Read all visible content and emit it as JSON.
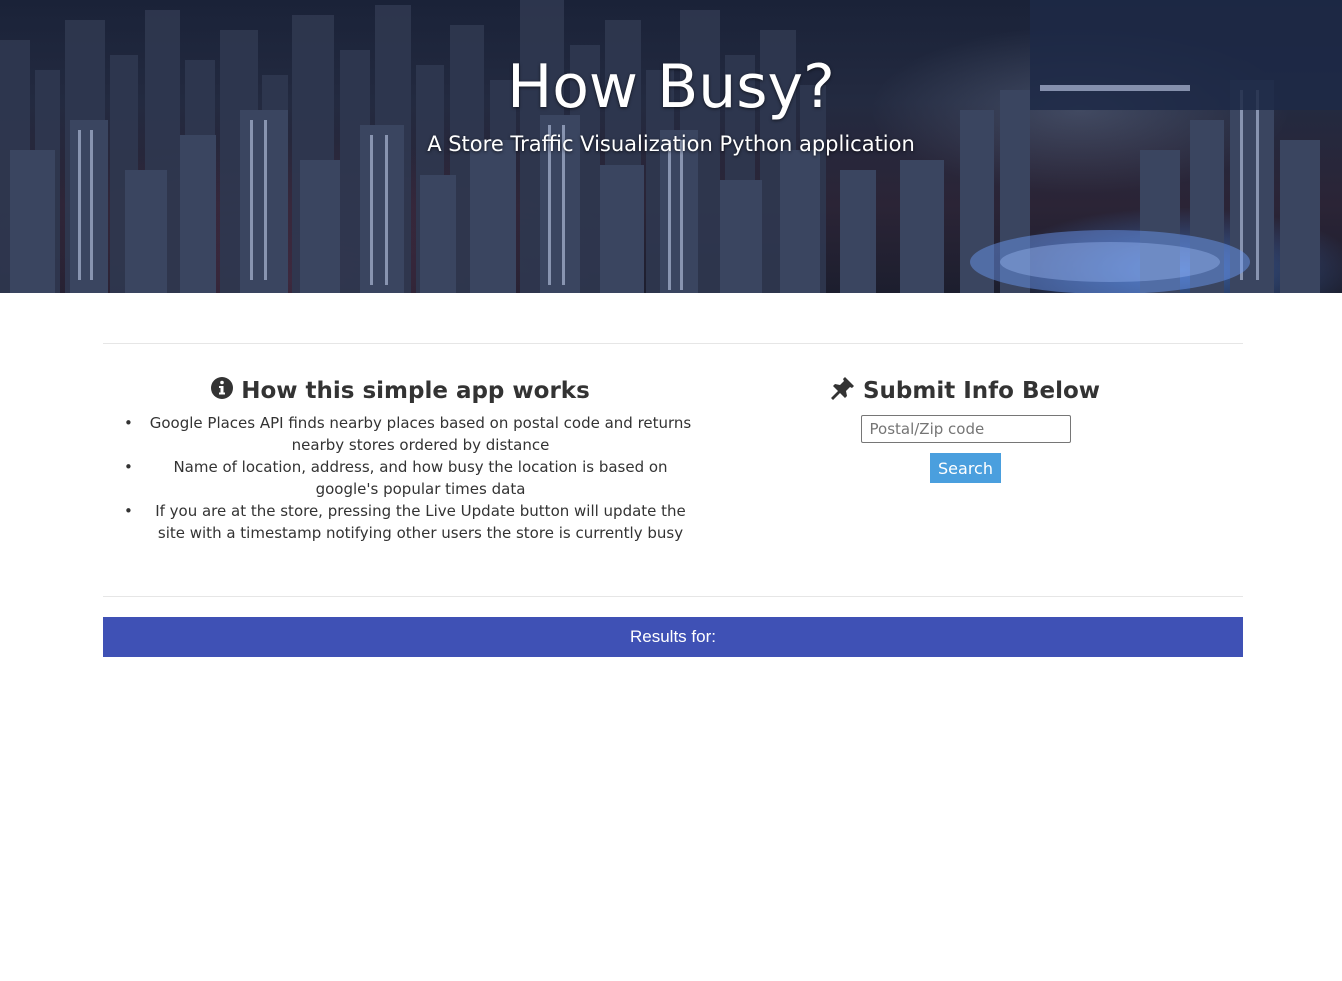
{
  "hero": {
    "title": "How Busy?",
    "subtitle": "A Store Traffic Visualization Python application"
  },
  "how_it_works": {
    "icon": "info-circle-icon",
    "heading": "How this simple app works",
    "items": [
      "Google Places API finds nearby places based on postal code and returns nearby stores ordered by distance",
      "Name of location, address, and how busy the location is based on google's popular times data",
      "If you are at the store, pressing the Live Update button will update the site with a timestamp notifying other users the store is currently busy"
    ]
  },
  "submit": {
    "icon": "pushpin-icon",
    "heading": "Submit Info Below",
    "postal_placeholder": "Postal/Zip code",
    "postal_value": "",
    "search_label": "Search"
  },
  "results": {
    "label": "Results for:"
  },
  "colors": {
    "results_bar": "#3f51b5",
    "search_button": "#4a9fde",
    "text": "#333333"
  }
}
